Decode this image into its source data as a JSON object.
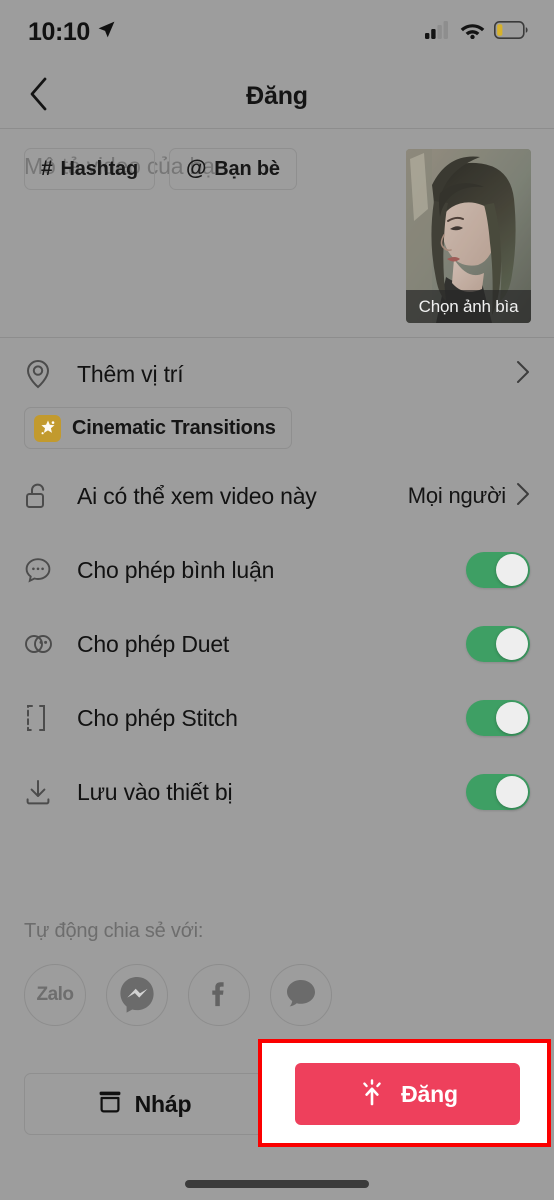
{
  "status_bar": {
    "time": "10:10",
    "location_icon": "location-arrow-icon",
    "signal_icon": "cellular-signal-icon",
    "wifi_icon": "wifi-icon",
    "battery_icon": "battery-low-icon",
    "battery_color": "#d7b22a"
  },
  "header": {
    "back_icon": "back-chevron-icon",
    "title": "Đăng"
  },
  "description": {
    "placeholder": "Mô tả video của bạn",
    "value": "",
    "chips": [
      {
        "glyph": "#",
        "label": "Hashtag",
        "icon": "hashtag-icon"
      },
      {
        "glyph": "@",
        "label": "Bạn bè",
        "icon": "at-mention-icon"
      }
    ]
  },
  "cover": {
    "label": "Chọn ảnh bìa",
    "icon": "cover-thumbnail"
  },
  "settings": {
    "location_row": {
      "icon": "location-pin-icon",
      "label": "Thêm vị trí",
      "chevron": "chevron-right-icon"
    },
    "cinematic": {
      "badge_icon": "sparkle-badge-icon",
      "label": "Cinematic Transitions",
      "badge_color": "#c29a2e"
    },
    "privacy_row": {
      "icon": "unlock-icon",
      "label": "Ai có thể xem video này",
      "value": "Mọi người",
      "chevron": "chevron-right-icon"
    },
    "toggle_rows": [
      {
        "icon": "comment-bubble-icon",
        "label": "Cho phép bình luận",
        "state": "on"
      },
      {
        "icon": "duet-circles-icon",
        "label": "Cho phép Duet",
        "state": "on"
      },
      {
        "icon": "stitch-bracket-icon",
        "label": "Cho phép Stitch",
        "state": "on"
      },
      {
        "icon": "download-icon",
        "label": "Lưu vào thiết bị",
        "state": "on"
      }
    ],
    "toggle_on_color": "#3e9f64"
  },
  "auto_share": {
    "title": "Tự động chia sẻ với:",
    "targets": [
      {
        "name": "Zalo",
        "icon": "zalo-icon"
      },
      {
        "name": "Messenger",
        "icon": "messenger-icon"
      },
      {
        "name": "Facebook",
        "icon": "facebook-icon"
      },
      {
        "name": "SMS",
        "icon": "message-bubble-icon"
      }
    ]
  },
  "bottom_bar": {
    "draft": {
      "icon": "archive-box-icon",
      "label": "Nháp"
    },
    "post": {
      "icon": "upload-sparkle-icon",
      "label": "Đăng",
      "color": "#ee405c"
    }
  },
  "annotation": {
    "highlight_color": "#fb0000",
    "target": "post-button"
  }
}
